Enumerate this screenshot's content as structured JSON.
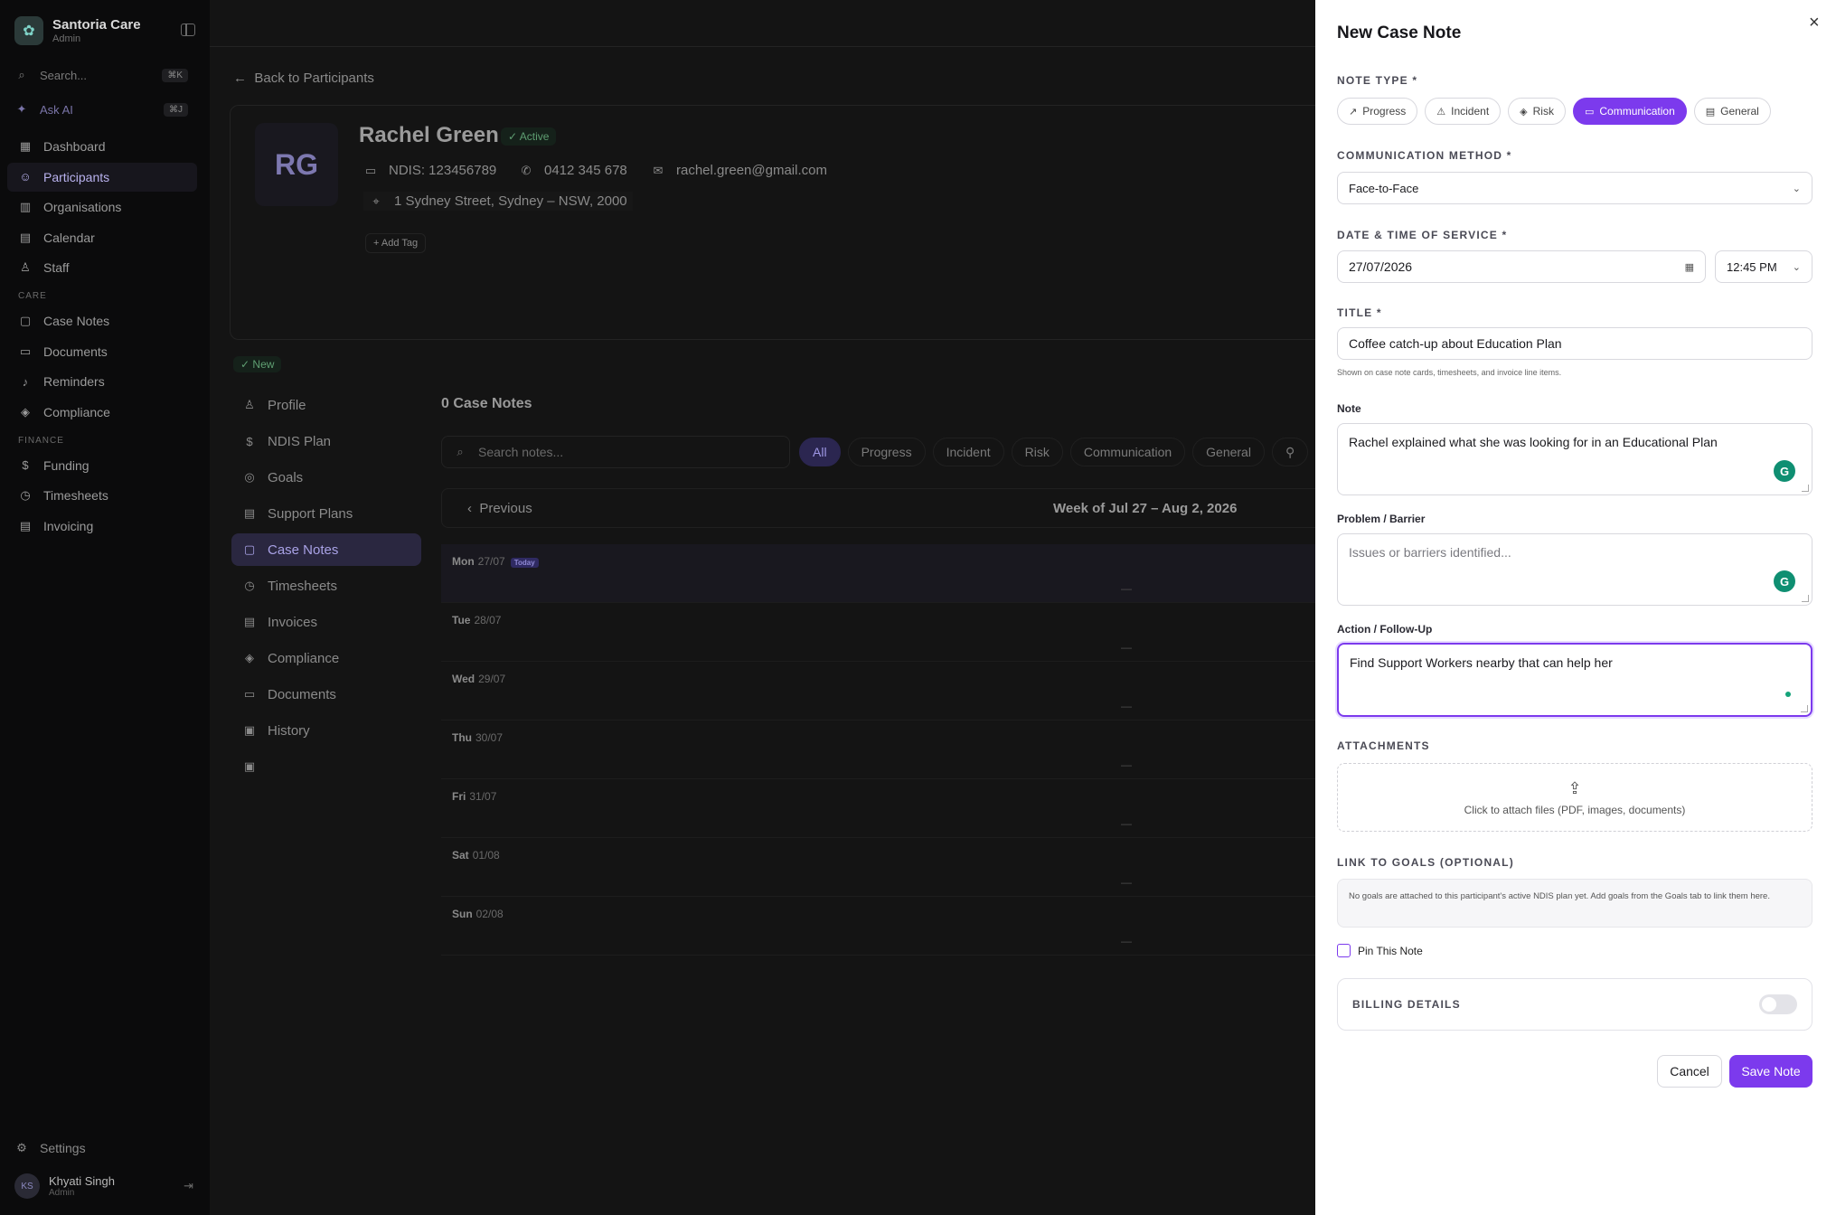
{
  "sidebar": {
    "brand_name": "Santoria Care",
    "brand_sub": "Admin",
    "search_placeholder": "Search...",
    "search_shortcut": "⌘K",
    "ask_ai": "Ask AI",
    "ask_ai_shortcut": "⌘J",
    "main_items": [
      {
        "label": "Dashboard",
        "icon": "grid-icon"
      },
      {
        "label": "Participants",
        "icon": "users-icon"
      },
      {
        "label": "Organisations",
        "icon": "building-icon"
      },
      {
        "label": "Calendar",
        "icon": "calendar-icon"
      },
      {
        "label": "Staff",
        "icon": "staff-icon"
      }
    ],
    "care_section": "CARE",
    "care_items": [
      {
        "label": "Case Notes",
        "icon": "note-icon"
      },
      {
        "label": "Documents",
        "icon": "folder-icon"
      },
      {
        "label": "Reminders",
        "icon": "bell-icon"
      },
      {
        "label": "Compliance",
        "icon": "shield-icon"
      }
    ],
    "finance_section": "FINANCE",
    "finance_items": [
      {
        "label": "Funding",
        "icon": "dollar-icon"
      },
      {
        "label": "Timesheets",
        "icon": "clock-icon"
      },
      {
        "label": "Invoicing",
        "icon": "invoice-icon"
      }
    ],
    "settings": "Settings",
    "user_initials": "KS",
    "user_name": "Khyati Singh",
    "user_role": "Admin"
  },
  "participant": {
    "back": "Back to Participants",
    "initials": "RG",
    "name": "Rachel Green",
    "status": "Active",
    "ndis": "NDIS: 123456789",
    "phone": "0412 345 678",
    "email": "rachel.green@gmail.com",
    "address": "1 Sydney Street, Sydney – NSW, 2000",
    "add_tag": "Add Tag",
    "new_badge": "New"
  },
  "subnav": [
    {
      "label": "Profile",
      "icon": "user-icon"
    },
    {
      "label": "NDIS Plan",
      "icon": "dollar-icon"
    },
    {
      "label": "Goals",
      "icon": "target-icon"
    },
    {
      "label": "Support Plans",
      "icon": "clipboard-icon"
    },
    {
      "label": "Case Notes",
      "icon": "note-icon"
    },
    {
      "label": "Timesheets",
      "icon": "clock-icon"
    },
    {
      "label": "Invoices",
      "icon": "invoice-icon"
    },
    {
      "label": "Compliance",
      "icon": "shield-icon"
    },
    {
      "label": "Documents",
      "icon": "folder-icon"
    },
    {
      "label": "History",
      "icon": "history-icon"
    },
    {
      "label": "",
      "icon": "archive-icon"
    }
  ],
  "case_notes": {
    "title": "0 Case Notes",
    "search_placeholder": "Search notes...",
    "filters": [
      "All",
      "Progress",
      "Incident",
      "Risk",
      "Communication",
      "General"
    ],
    "previous": "Previous",
    "week_label": "Week of Jul 27 – Aug 2, 2026",
    "today_tag": "Today",
    "empty_mark": "—",
    "days": [
      {
        "day": "Mon",
        "date": "27/07"
      },
      {
        "day": "Tue",
        "date": "28/07"
      },
      {
        "day": "Wed",
        "date": "29/07"
      },
      {
        "day": "Thu",
        "date": "30/07"
      },
      {
        "day": "Fri",
        "date": "31/07"
      },
      {
        "day": "Sat",
        "date": "01/08"
      },
      {
        "day": "Sun",
        "date": "02/08"
      }
    ]
  },
  "modal": {
    "title": "New Case Note",
    "note_type_label": "NOTE TYPE *",
    "note_types": [
      {
        "label": "Progress",
        "icon": "trend-icon"
      },
      {
        "label": "Incident",
        "icon": "warning-icon"
      },
      {
        "label": "Risk",
        "icon": "shield-icon"
      },
      {
        "label": "Communication",
        "icon": "message-icon"
      },
      {
        "label": "General",
        "icon": "document-icon"
      }
    ],
    "comm_method_label": "COMMUNICATION METHOD *",
    "comm_method_value": "Face-to-Face",
    "datetime_label": "DATE & TIME OF SERVICE *",
    "date_value": "27/07/2026",
    "time_value": "12:45 PM",
    "title_label": "TITLE *",
    "title_value": "Coffee catch-up about Education Plan",
    "title_hint": "Shown on case note cards, timesheets, and invoice line items.",
    "note_label": "Note",
    "note_value": "Rachel explained what she was looking for in an Educational Plan",
    "problem_label": "Problem / Barrier",
    "problem_placeholder": "Issues or barriers identified...",
    "action_label": "Action / Follow-Up",
    "action_value": "Find Support Workers nearby that can help her",
    "attachments_label": "ATTACHMENTS",
    "attachments_text": "Click to attach files (PDF, images, documents)",
    "goals_label": "LINK TO GOALS (OPTIONAL)",
    "goals_text": "No goals are attached to this participant's active NDIS plan yet. Add goals from the Goals tab to link them here.",
    "pin_label": "Pin This Note",
    "billing_label": "BILLING DETAILS",
    "cancel": "Cancel",
    "save": "Save Note",
    "accent_color": "#7c3aed"
  }
}
